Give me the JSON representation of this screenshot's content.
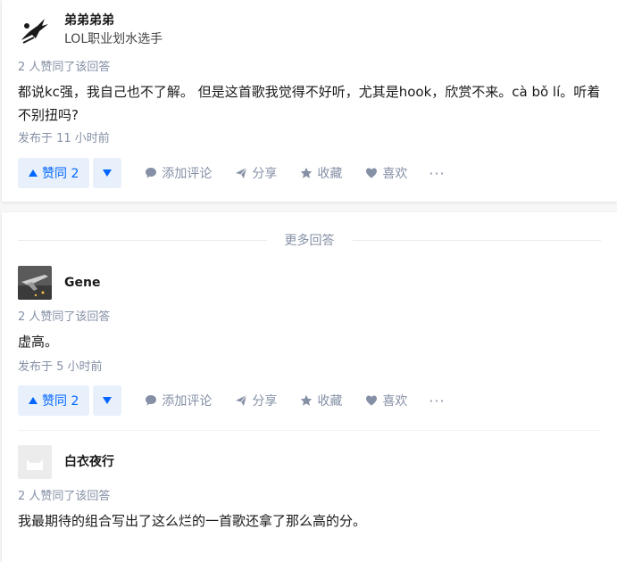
{
  "answers": [
    {
      "author_name": "弟弟弟弟",
      "author_headline": "LOL职业划水选手",
      "votes_meta": "2 人赞同了该回答",
      "content": "都说kc强，我自己也不了解。 但是这首歌我觉得不好听，尤其是hook，欣赏不来。cà bǒ lí。听着不别扭吗?",
      "time": "发布于 11 小时前",
      "vote_up_label": "赞同 2"
    },
    {
      "author_name": "Gene",
      "votes_meta": "2 人赞同了该回答",
      "content": "虚高。",
      "time": "发布于 5 小时前",
      "vote_up_label": "赞同 2"
    },
    {
      "author_name": "白衣夜行",
      "votes_meta": "2 人赞同了该回答",
      "content": "我最期待的组合写出了这么烂的一首歌还拿了那么高的分。"
    }
  ],
  "actions": {
    "comment": "添加评论",
    "share": "分享",
    "favorite": "收藏",
    "like": "喜欢",
    "more": "···"
  },
  "more_answers_label": "更多回答",
  "colors": {
    "accent": "#0066ff",
    "vote_bg": "#e8f0fc",
    "meta": "#8590a6"
  }
}
